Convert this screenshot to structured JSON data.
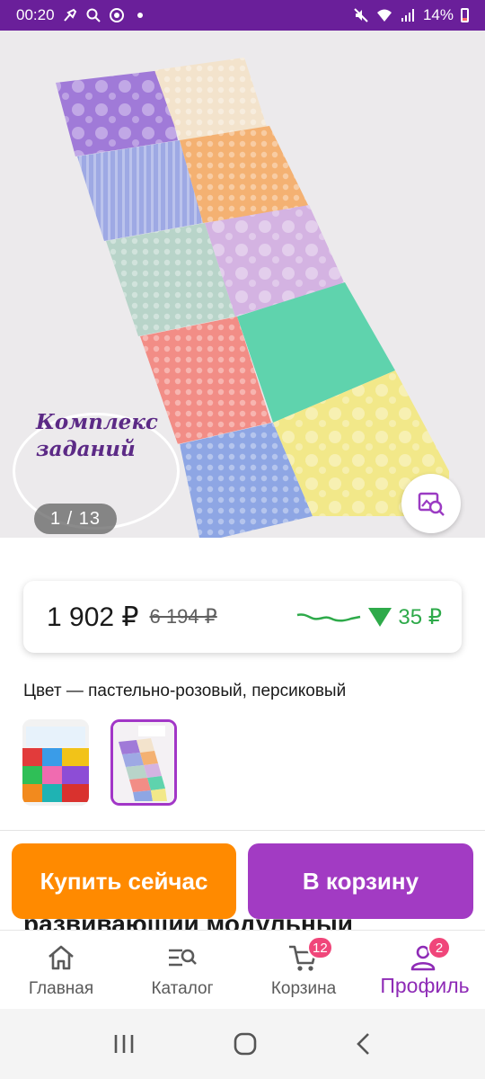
{
  "status_bar": {
    "time": "00:20",
    "battery": "14%"
  },
  "gallery": {
    "caption": "Комплекс\nзаданий",
    "counter": "1 / 13"
  },
  "price": {
    "current": "1 902 ₽",
    "old": "6 194 ₽",
    "drop": "35 ₽"
  },
  "color": {
    "label": "Цвет — пастельно-розовый, персиковый"
  },
  "product": {
    "title_partial": "развивающий модульный"
  },
  "actions": {
    "buy_now": "Купить сейчас",
    "add_to_cart": "В корзину"
  },
  "tabs": [
    {
      "label": "Главная",
      "icon": "home-icon"
    },
    {
      "label": "Каталог",
      "icon": "catalog-search-icon"
    },
    {
      "label": "Корзина",
      "icon": "cart-icon",
      "badge": "12"
    },
    {
      "label": "Профиль",
      "icon": "profile-icon",
      "badge": "2",
      "active": true
    }
  ],
  "colors": {
    "accent": "#a23bc3",
    "buy": "#ff8a00",
    "status_bar": "#6a1f9a",
    "price_drop": "#2eaa4a",
    "badge": "#f0467a"
  }
}
